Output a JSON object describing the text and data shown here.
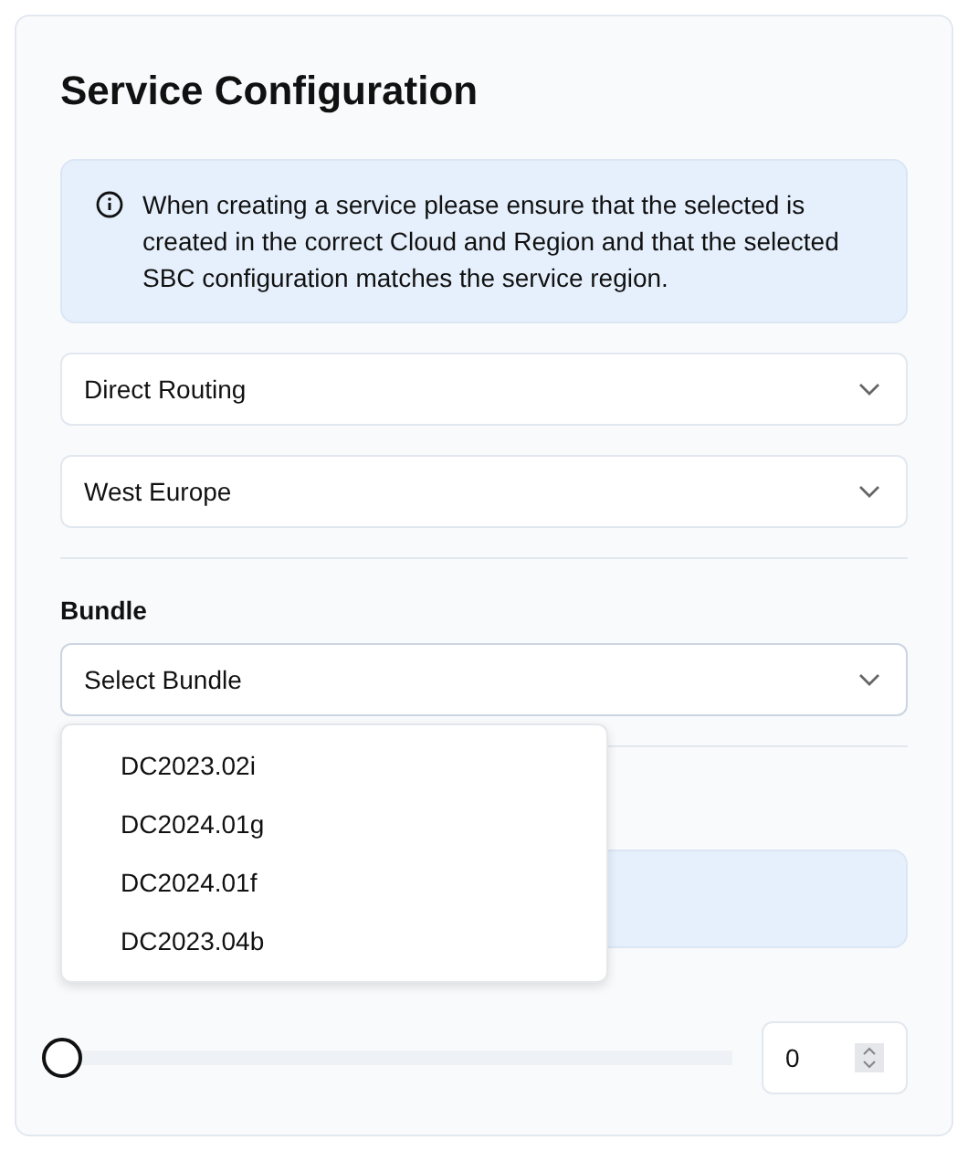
{
  "title": "Service Configuration",
  "notice": "When creating a service please ensure that the selected is created in the correct Cloud and Region and that the selected SBC configuration matches the service region.",
  "selects": [
    {
      "value": "Direct Routing"
    },
    {
      "value": "West Europe"
    }
  ],
  "bundle": {
    "label": "Bundle",
    "value": "Select Bundle",
    "expanded": true,
    "options": [
      "DC2023.02i",
      "DC2024.01g",
      "DC2024.01f",
      "DC2023.04b"
    ]
  },
  "slider": {
    "level": 0,
    "value": "0"
  }
}
